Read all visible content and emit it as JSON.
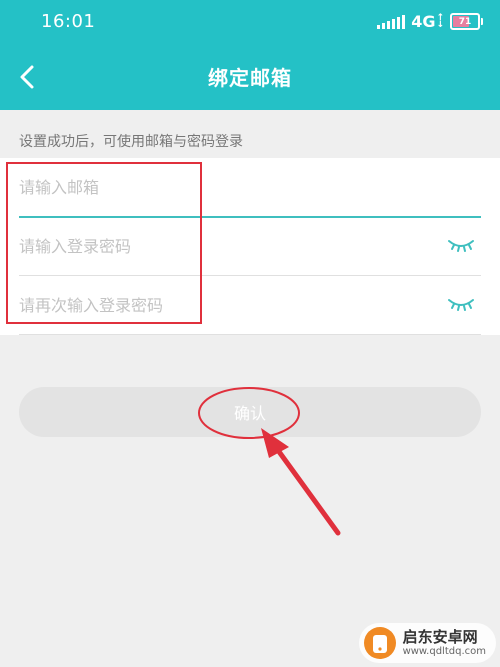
{
  "status_bar": {
    "time": "16:01",
    "network": "4G",
    "battery": "71"
  },
  "header": {
    "title": "绑定邮箱",
    "back_icon": "chevron-left-icon"
  },
  "hint": "设置成功后，可使用邮箱与密码登录",
  "form": {
    "email_placeholder": "请输入邮箱",
    "password_placeholder": "请输入登录密码",
    "confirm_password_placeholder": "请再次输入登录密码",
    "visibility_icon": "eye-closed-icon"
  },
  "confirm_button": "确认",
  "watermark": {
    "name": "启东安卓网",
    "url": "www.qdltdq.com"
  },
  "colors": {
    "header_bg": "#24c1c6",
    "accent": "#3fbfbf",
    "annotation_red": "#e0303c",
    "button_disabled": "#e3e3e3"
  }
}
